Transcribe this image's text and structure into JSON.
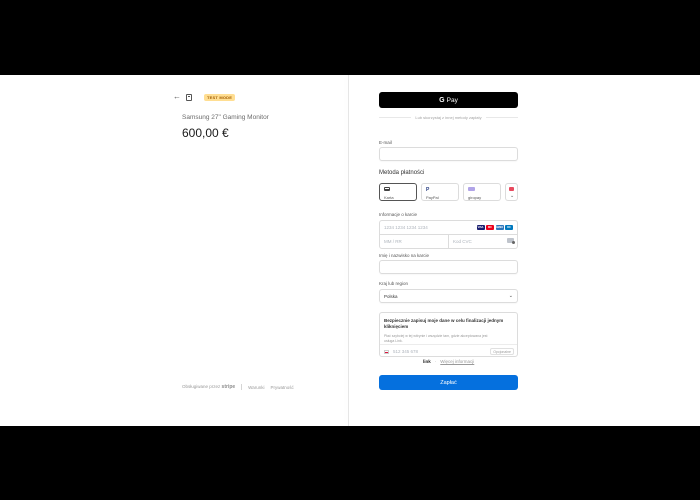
{
  "header": {
    "badge": "TEST MODE"
  },
  "product": {
    "name": "Samsung 27\" Gaming Monitor",
    "price": "600,00 €"
  },
  "footer": {
    "powered_by": "Obsługiwane przez",
    "stripe": "stripe",
    "terms": "Warunki",
    "privacy": "Prywatność"
  },
  "payment": {
    "gpay_label": "Pay",
    "or_text": "Lub skorzystaj z innej metody zapłaty",
    "email_label": "E-mail",
    "method_title": "Metoda płatności",
    "methods": [
      {
        "label": "Karta",
        "icon": "card-icon"
      },
      {
        "label": "PayPal",
        "icon": "paypal-icon"
      },
      {
        "label": "giropay",
        "icon": "giropay-icon"
      },
      {
        "label": "⌄",
        "icon": "more-methods-icon"
      }
    ],
    "card_label": "Informacje o karcie",
    "card_number_placeholder": "1234 1234 1234 1234",
    "expiry_placeholder": "MM / RR",
    "cvc_placeholder": "Kod CVC",
    "brands": [
      "VISA",
      "MC",
      "AMEX",
      "DC"
    ],
    "name_label": "Imię i nazwisko na karcie",
    "country_label": "Kraj lub region",
    "country_value": "Polska",
    "link_checkbox": "Bezpiecznie zapisuj moje dane w celu finalizacji jednym kliknięciem",
    "link_desc": "Płać szybciej w tej witrynie i wszędzie tam, gdzie akceptowana jest usługa Link.",
    "phone_placeholder": "512 345 678",
    "optional": "Opcjonalne",
    "link_brand": "link",
    "more_info": "Więcej informacji",
    "pay_button": "Zapłać"
  },
  "colors": {
    "pay_button": "#0570de",
    "gpay_button": "#000000",
    "test_badge": "#ffde92"
  }
}
